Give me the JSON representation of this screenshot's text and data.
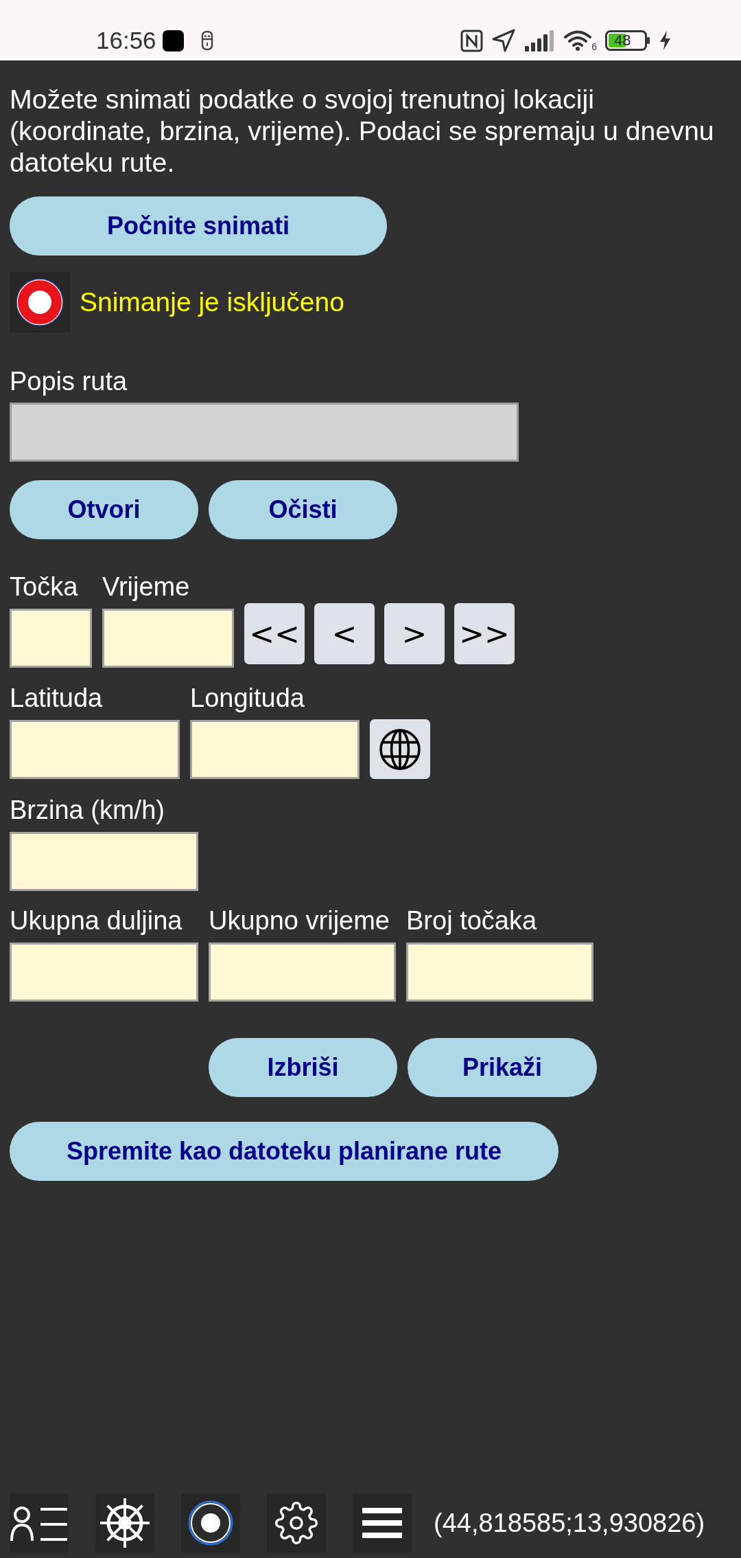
{
  "status_bar": {
    "time": "16:56",
    "wifi_badge": "6",
    "battery": "48"
  },
  "intro": "Možete snimati podatke o svojoj trenutnoj lokaciji (koordinate, brzina, vrijeme). Podaci se spremaju u dnevnu datoteku rute.",
  "start_button": {
    "label": "Počnite snimati"
  },
  "recording": {
    "active": false,
    "status": "Snimanje je isključeno"
  },
  "route_list": {
    "label": "Popis ruta"
  },
  "route_buttons": [
    {
      "label": "Otvori"
    },
    {
      "label": "Očisti"
    }
  ],
  "point_fields": [
    {
      "label": "Točka"
    },
    {
      "label": "Vrijeme"
    }
  ],
  "nav_buttons": [
    {
      "label": "<<"
    },
    {
      "label": "<"
    },
    {
      "label": ">"
    },
    {
      "label": ">>"
    }
  ],
  "coordinate_fields": [
    {
      "label": "Latituda"
    },
    {
      "label": "Longituda"
    }
  ],
  "speed_field": {
    "label": "Brzina (km/h)"
  },
  "total_fields": [
    {
      "label": "Ukupna duljina"
    },
    {
      "label": "Ukupno vrijeme"
    },
    {
      "label": "Broj točaka"
    }
  ],
  "action_buttons": [
    {
      "label": "Izbriši"
    },
    {
      "label": "Prikaži"
    }
  ],
  "save_button": {
    "label": "Spremite kao datoteku planirane rute"
  },
  "bottom_bar": {
    "coordinates": "(44,818585;13,930826)"
  }
}
